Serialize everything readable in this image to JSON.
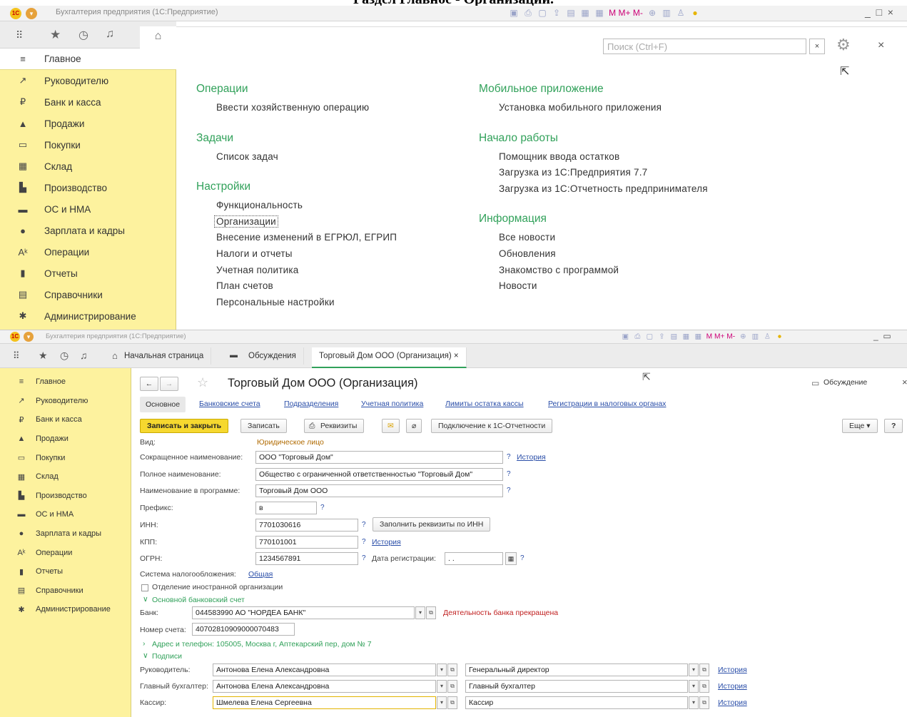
{
  "caption": "Раздел Главное - Организации.",
  "app_title": "Бухгалтерия предприятия (1С:Предприятие)",
  "sidebar_items": [
    {
      "label": "Главное",
      "icon": "≡"
    },
    {
      "label": "Руководителю",
      "icon": "↗"
    },
    {
      "label": "Банк и касса",
      "icon": "₽"
    },
    {
      "label": "Продажи",
      "icon": "▲"
    },
    {
      "label": "Покупки",
      "icon": "▭"
    },
    {
      "label": "Склад",
      "icon": "▦"
    },
    {
      "label": "Производство",
      "icon": "▙"
    },
    {
      "label": "ОС и НМА",
      "icon": "▬"
    },
    {
      "label": "Зарплата и кадры",
      "icon": "●"
    },
    {
      "label": "Операции",
      "icon": "Aᵏ"
    },
    {
      "label": "Отчеты",
      "icon": "▮"
    },
    {
      "label": "Справочники",
      "icon": "▤"
    },
    {
      "label": "Администрирование",
      "icon": "✱"
    }
  ],
  "search_placeholder": "Поиск (Ctrl+F)",
  "close_symbol": "×",
  "left_sections": [
    {
      "title": "Операции",
      "links": [
        "Ввести хозяйственную операцию"
      ]
    },
    {
      "title": "Задачи",
      "links": [
        "Список задач"
      ]
    },
    {
      "title": "Настройки",
      "links": [
        "Функциональность",
        "Организации",
        "Внесение изменений в ЕГРЮЛ, ЕГРИП",
        "Налоги и отчеты",
        "Учетная политика",
        "План счетов",
        "Персональные настройки"
      ]
    }
  ],
  "right_sections": [
    {
      "title": "Мобильное приложение",
      "links": [
        "Установка мобильного приложения"
      ]
    },
    {
      "title": "Начало работы",
      "links": [
        "Помощник ввода остатков",
        "Загрузка из 1С:Предприятия 7.7",
        "Загрузка из 1С:Отчетность предпринимателя"
      ]
    },
    {
      "title": "Информация",
      "links": [
        "Все новости",
        "Обновления",
        "Знакомство с программой",
        "Новости"
      ]
    }
  ],
  "tabs": [
    "Начальная страница",
    "Обсуждения",
    "Торговый Дом ООО (Организация) ×"
  ],
  "form": {
    "title": "Торговый Дом ООО (Организация)",
    "discussion": "Обсуждение",
    "subtabs": [
      "Основное",
      "Банковские счета",
      "Подразделения",
      "Учетная политика",
      "Лимиты остатка кассы",
      "Регистрации в налоговых органах"
    ],
    "btn_save_close": "Записать и закрыть",
    "btn_save": "Записать",
    "btn_rekvizity": "Реквизиты",
    "btn_connect": "Подключение к 1С-Отчетности",
    "btn_more": "Еще ▾",
    "btn_help": "?",
    "vid_label": "Вид:",
    "vid_value": "Юридическое лицо",
    "short_label": "Сокращенное наименование:",
    "short_value": "ООО \"Торговый Дом\"",
    "full_label": "Полное наименование:",
    "full_value": "Общество с ограниченной ответственностью \"Торговый Дом\"",
    "prog_label": "Наименование в программе:",
    "prog_value": "Торговый Дом ООО",
    "prefix_label": "Префикс:",
    "prefix_value": "в",
    "inn_label": "ИНН:",
    "inn_value": "7701030616",
    "inn_btn": "Заполнить реквизиты по ИНН",
    "kpp_label": "КПП:",
    "kpp_value": "770101001",
    "ogrn_label": "ОГРН:",
    "ogrn_value": "1234567891",
    "date_label": "Дата регистрации:",
    "date_value": " .  .",
    "history": "История",
    "q": "?",
    "tax_label": "Система налогообложения:",
    "tax_value": "Общая",
    "foreign_label": "Отделение иностранной организации",
    "bank_section": "Основной банковский счет",
    "bank_label": "Банк:",
    "bank_value": "044583990 АО \"НОРДЕА БАНК\"",
    "bank_warning": "Деятельность банка прекращена",
    "acc_label": "Номер счета:",
    "acc_value": "40702810909000070483",
    "address": "Адрес и телефон: 105005, Москва г, Аптекарский пер, дом № 7",
    "signatures": "Подписи",
    "sign_rows": [
      {
        "label": "Руководитель:",
        "name": "Антонова Елена Александровна",
        "position": "Генеральный директор"
      },
      {
        "label": "Главный бухгалтер:",
        "name": "Антонова Елена Александровна",
        "position": "Главный бухгалтер"
      },
      {
        "label": "Кассир:",
        "name": "Шмелева Елена Сергеевна",
        "position": "Кассир"
      }
    ]
  }
}
